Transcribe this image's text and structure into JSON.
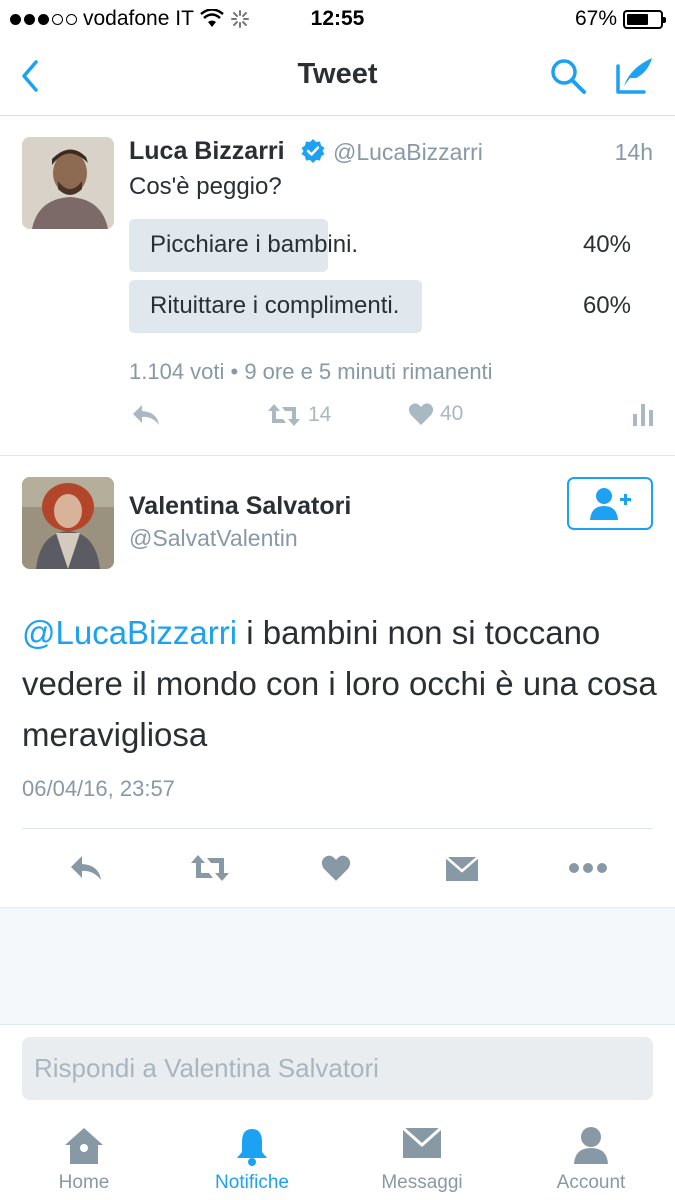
{
  "status_bar": {
    "carrier": "vodafone IT",
    "time": "12:55",
    "battery_pct": "67%",
    "battery_level": 0.67
  },
  "nav": {
    "title": "Tweet"
  },
  "poll_tweet": {
    "name": "Luca Bizzarri",
    "handle": "@LucaBizzarri",
    "time_ago": "14h",
    "text": "Cos'è peggio?",
    "options": [
      {
        "label": "Picchiare i bambini.",
        "percent_text": "40%",
        "percent": 40
      },
      {
        "label": "Rituittare i complimenti.",
        "percent_text": "60%",
        "percent": 60
      }
    ],
    "meta": "1.104 voti • 9 ore e 5 minuti rimanenti",
    "retweets": "14",
    "likes": "40"
  },
  "reply_tweet": {
    "name": "Valentina Salvatori",
    "handle": "@SalvatValentin",
    "mention": "@LucaBizzarri",
    "text": " i bambini non si toccano vedere il mondo con i loro occhi è una cosa meravigliosa",
    "date": "06/04/16, 23:57"
  },
  "reply_box": {
    "placeholder": "Rispondi a Valentina Salvatori"
  },
  "tabs": [
    {
      "label": "Home",
      "icon": "home-icon"
    },
    {
      "label": "Notifiche",
      "icon": "bell-icon"
    },
    {
      "label": "Messaggi",
      "icon": "envelope-icon"
    },
    {
      "label": "Account",
      "icon": "person-icon"
    }
  ],
  "colors": {
    "accent": "#1da1f2",
    "muted": "#8899a6",
    "poll_bar": "#e1e8ed"
  }
}
